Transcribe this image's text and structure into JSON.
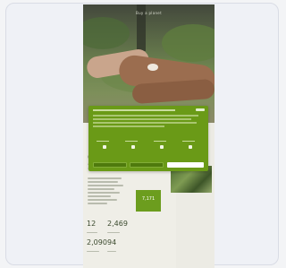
{
  "hero": {
    "title": "Buy a planet"
  },
  "badge": {
    "text": "7,171"
  },
  "stats": [
    {
      "value": "12",
      "label": ""
    },
    {
      "value": "2,469",
      "label": ""
    },
    {
      "value": "2,090",
      "label": ""
    },
    {
      "value": "94",
      "label": ""
    }
  ],
  "cookie_modal": {
    "toggles": [
      {
        "label": ""
      },
      {
        "label": ""
      },
      {
        "label": ""
      },
      {
        "label": ""
      }
    ],
    "buttons": [
      {
        "label": ""
      },
      {
        "label": ""
      },
      {
        "label": ""
      }
    ]
  },
  "colors": {
    "accent": "#6a9a17",
    "badge": "#6c9d1e",
    "text_dark": "#3b4a2e"
  }
}
